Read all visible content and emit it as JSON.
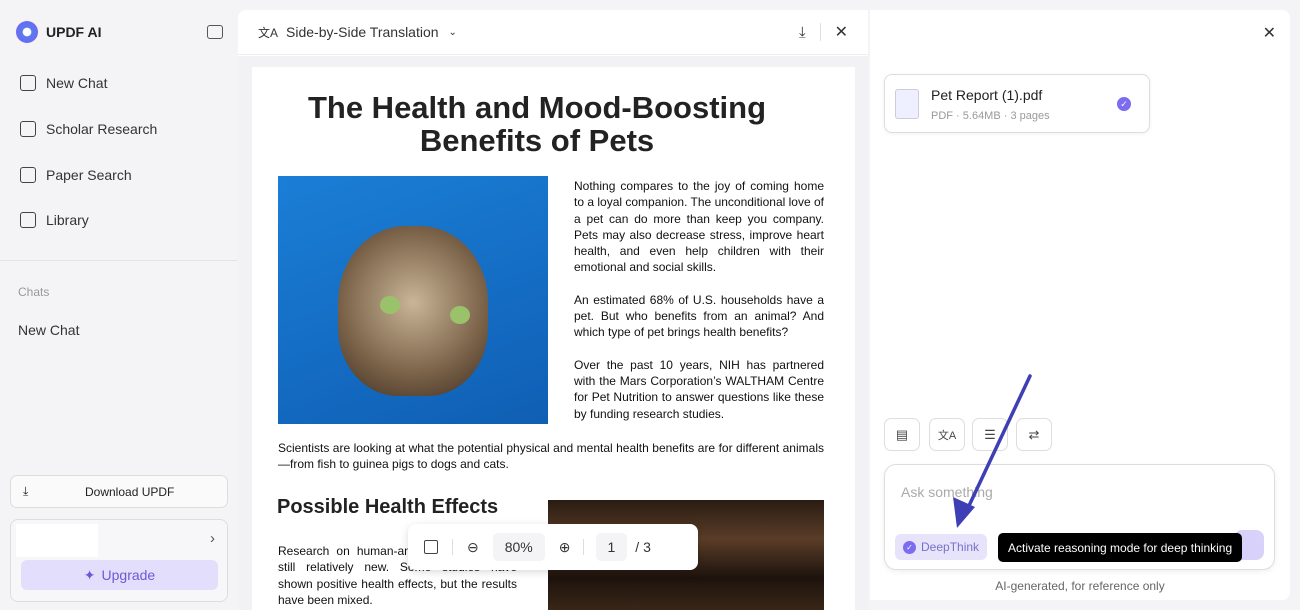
{
  "sidebar": {
    "brand": "UPDF AI",
    "items": [
      {
        "label": "New Chat",
        "icon": "edit-icon"
      },
      {
        "label": "Scholar Research",
        "icon": "telescope-icon"
      },
      {
        "label": "Paper Search",
        "icon": "search-doc-icon"
      },
      {
        "label": "Library",
        "icon": "library-icon"
      }
    ],
    "chats_heading": "Chats",
    "chats": [
      "New Chat"
    ],
    "download_label": "Download UPDF",
    "upgrade_label": "Upgrade"
  },
  "doc": {
    "mode": "Side-by-Side Translation",
    "title": "The Health and Mood-Boosting Benefits of Pets",
    "paragraphs": [
      "Nothing compares to the joy of coming home to a loyal companion. The unconditional love of a pet can do more than keep you company. Pets may also decrease stress, improve heart health, and even help children with their emotional and social skills.",
      "An estimated 68% of U.S. households have a pet. But who benefits from an animal? And which type of pet brings health benefits?",
      "Over the past 10 years, NIH has partnered with the Mars Corporation’s WALTHAM Centre for Pet Nutrition to answer questions like these by funding research studies."
    ],
    "wide_paragraph": "Scientists are looking at what the potential physical and mental health benefits are for different animals—from fish to guinea pigs to dogs and cats.",
    "section_heading": "Possible Health Effects",
    "section_text": "Research on human-animal interactions is still relatively new. Some studies have shown positive health effects, but the results have been mixed."
  },
  "zoombar": {
    "zoom": "80%",
    "page": "1",
    "total": "/ 3"
  },
  "right": {
    "file": {
      "name": "Pet Report (1).pdf",
      "meta": "PDF · 5.64MB · 3 pages"
    },
    "input_placeholder": "Ask something",
    "deepthink": "DeepThink",
    "tooltip": "Activate reasoning mode for deep thinking",
    "footer": "AI-generated, for reference only"
  },
  "colors": {
    "accent": "#7b6cf0",
    "arrow": "#3f3fb5",
    "upgrade_bg": "#e3defc"
  }
}
